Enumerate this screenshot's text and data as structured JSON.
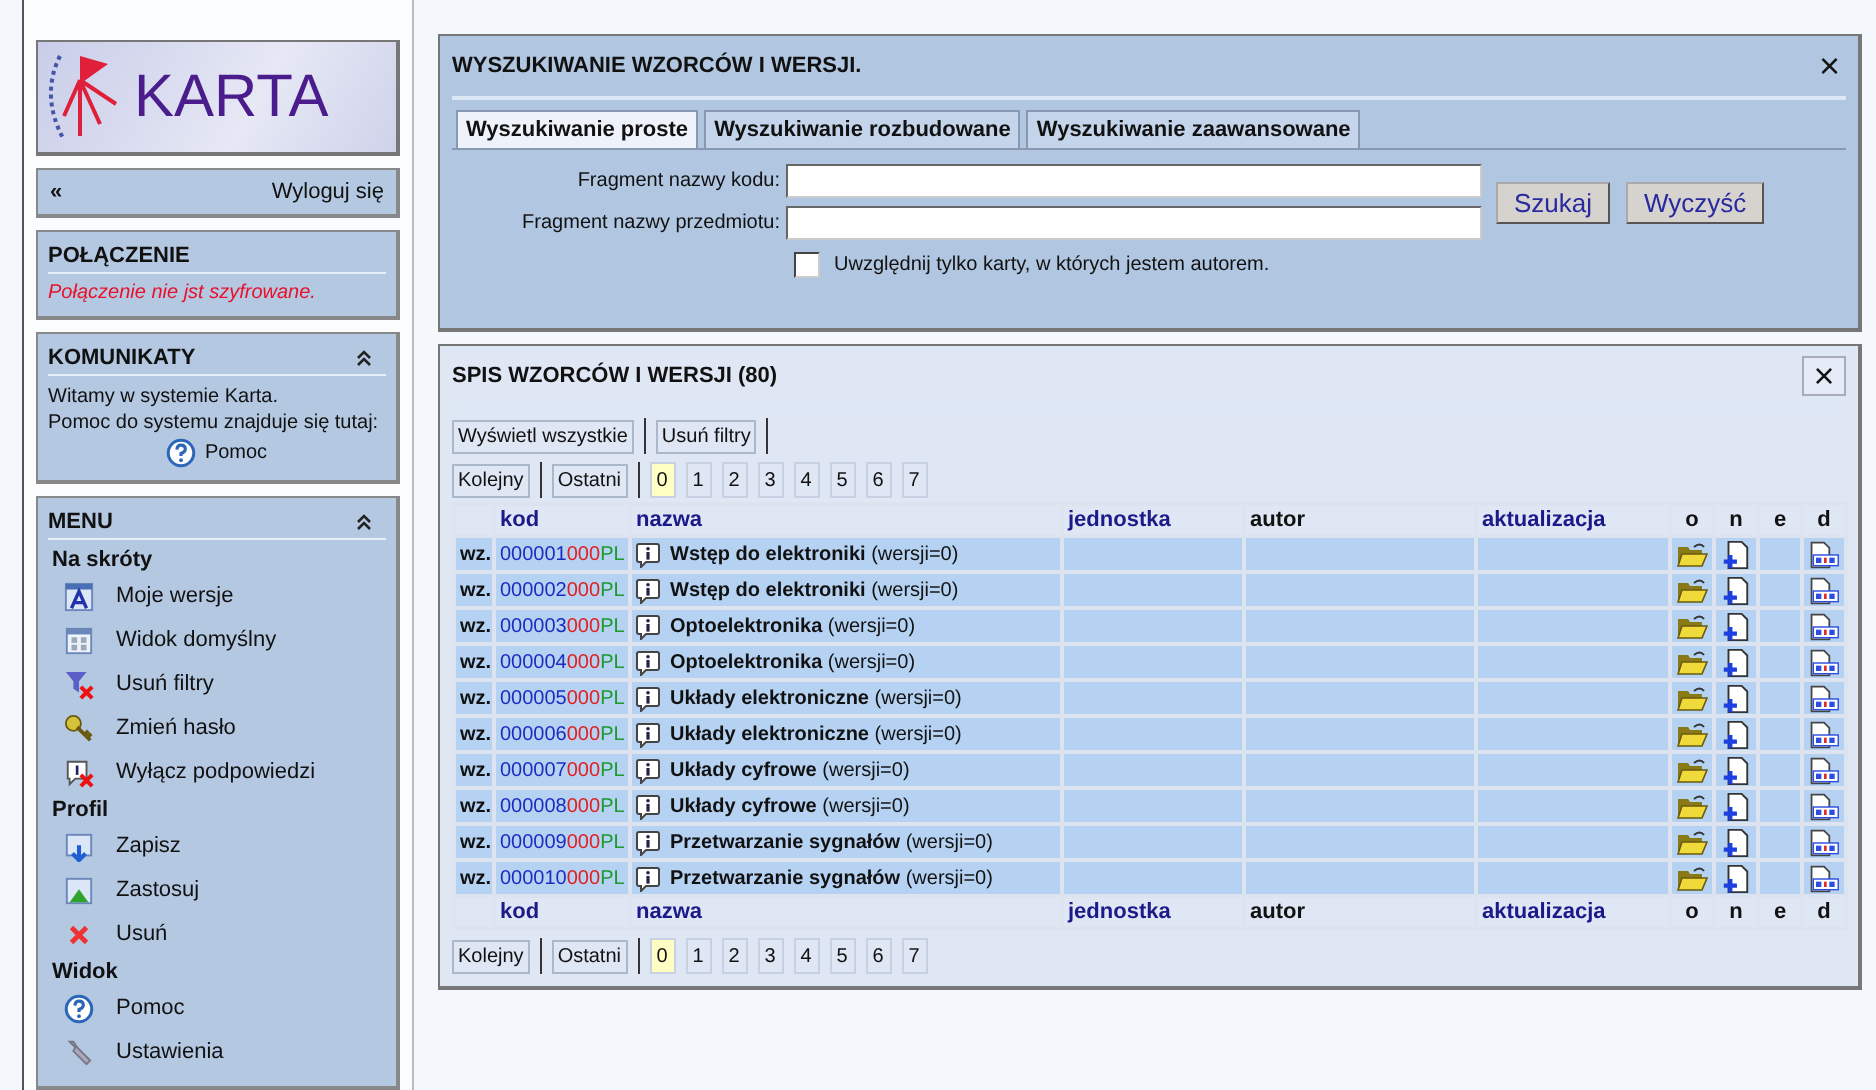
{
  "logo": {
    "text": "KARTA"
  },
  "nav": {
    "back": "«",
    "logout": "Wyloguj się"
  },
  "connection": {
    "title": "POŁĄCZENIE",
    "message": "Połączenie nie jst szyfrowane."
  },
  "messages": {
    "title": "KOMUNIKATY",
    "expanded": true,
    "lines": [
      "Witamy w systemie Karta.",
      "Pomoc do systemu znajduje się tutaj:"
    ],
    "help_link": "Pomoc"
  },
  "menu": {
    "title": "MENU",
    "expanded": true,
    "sections": [
      {
        "title": "Na skróty",
        "items": [
          {
            "label": "Moje wersje",
            "kind": "font"
          },
          {
            "label": "Widok domyślny",
            "kind": "grid"
          },
          {
            "label": "Usuń filtry",
            "kind": "filter"
          },
          {
            "label": "Zmień hasło",
            "kind": "key"
          },
          {
            "label": "Wyłącz podpowiedzi",
            "kind": "hint"
          }
        ]
      },
      {
        "title": "Profil",
        "items": [
          {
            "label": "Zapisz",
            "kind": "save"
          },
          {
            "label": "Zastosuj",
            "kind": "apply"
          },
          {
            "label": "Usuń",
            "kind": "delete"
          }
        ]
      },
      {
        "title": "Widok",
        "items": [
          {
            "label": "Pomoc",
            "kind": "help"
          },
          {
            "label": "Ustawienia",
            "kind": "wrench"
          }
        ]
      }
    ]
  },
  "search": {
    "title": "WYSZUKIWANIE WZORCÓW I WERSJI.",
    "close": "×",
    "tabs": [
      {
        "label": "Wyszukiwanie proste",
        "selected": true
      },
      {
        "label": "Wyszukiwanie rozbudowane",
        "selected": false
      },
      {
        "label": "Wyszukiwanie zaawansowane",
        "selected": false
      }
    ],
    "fields": [
      {
        "label": "Fragment nazwy kodu:"
      },
      {
        "label": "Fragment nazwy przedmiotu:"
      }
    ],
    "buttons": [
      "Szukaj",
      "Wyczyść"
    ],
    "only_mine": {
      "label": "Uwzględnij tylko karty, w których jestem autorem.",
      "checked": false
    }
  },
  "list": {
    "title": "SPIS WZORCÓW I WERSJI (80)",
    "close": "×",
    "actions": [
      "Wyświetl wszystkie",
      "Usuń filtry"
    ],
    "pager_top": {
      "nav": [
        "Kolejny",
        "Ostatni"
      ],
      "pages": [
        {
          "label": "0",
          "selected": true
        },
        {
          "label": "1",
          "selected": false
        },
        {
          "label": "2",
          "selected": false
        },
        {
          "label": "3",
          "selected": false
        },
        {
          "label": "4",
          "selected": false
        },
        {
          "label": "5",
          "selected": false
        },
        {
          "label": "6",
          "selected": false
        },
        {
          "label": "7",
          "selected": false
        }
      ]
    },
    "columns": [
      {
        "label": "kod",
        "sortable": true
      },
      {
        "label": "nazwa",
        "sortable": true
      },
      {
        "label": "jednostka",
        "sortable": true
      },
      {
        "label": "autor",
        "sortable": false
      },
      {
        "label": "aktualizacja",
        "sortable": true
      },
      {
        "label": "o",
        "sortable": false
      },
      {
        "label": "n",
        "sortable": false
      },
      {
        "label": "e",
        "sortable": false
      },
      {
        "label": "d",
        "sortable": false
      }
    ],
    "rows": [
      {
        "type": "wz.",
        "code": [
          "000001",
          "000",
          "PL"
        ],
        "name": "**Wstęp do elektroniki** (wersji=0)"
      },
      {
        "type": "wz.",
        "code": [
          "000002",
          "000",
          "PL"
        ],
        "name": "**Wstęp do elektroniki** (wersji=0)"
      },
      {
        "type": "wz.",
        "code": [
          "000003",
          "000",
          "PL"
        ],
        "name": "**Optoelektronika** (wersji=0)"
      },
      {
        "type": "wz.",
        "code": [
          "000004",
          "000",
          "PL"
        ],
        "name": "**Optoelektronika** (wersji=0)"
      },
      {
        "type": "wz.",
        "code": [
          "000005",
          "000",
          "PL"
        ],
        "name": "**Układy elektroniczne** (wersji=0)"
      },
      {
        "type": "wz.",
        "code": [
          "000006",
          "000",
          "PL"
        ],
        "name": "**Układy elektroniczne** (wersji=0)"
      },
      {
        "type": "wz.",
        "code": [
          "000007",
          "000",
          "PL"
        ],
        "name": "**Układy cyfrowe** (wersji=0)"
      },
      {
        "type": "wz.",
        "code": [
          "000008",
          "000",
          "PL"
        ],
        "name": "**Układy cyfrowe** (wersji=0)"
      },
      {
        "type": "wz.",
        "code": [
          "000009",
          "000",
          "PL"
        ],
        "name": "**Przetwarzanie sygnałów** (wersji=0)"
      },
      {
        "type": "wz.",
        "code": [
          "000010",
          "000",
          "PL"
        ],
        "name": "**Przetwarzanie sygnałów** (wersji=0)"
      }
    ],
    "footer_columns": [
      {
        "label": "kod",
        "sortable": true
      },
      {
        "label": "nazwa",
        "sortable": true
      },
      {
        "label": "jednostka",
        "sortable": true
      },
      {
        "label": "autor",
        "sortable": false
      },
      {
        "label": "aktualizacja",
        "sortable": true
      },
      {
        "label": "o",
        "sortable": false
      },
      {
        "label": "n",
        "sortable": false
      },
      {
        "label": "e",
        "sortable": false
      },
      {
        "label": "d",
        "sortable": false
      }
    ],
    "pager_bottom": {
      "nav": [
        "Kolejny",
        "Ostatni"
      ],
      "pages": [
        {
          "label": "0",
          "selected": true
        },
        {
          "label": "1",
          "selected": false
        },
        {
          "label": "2",
          "selected": false
        },
        {
          "label": "3",
          "selected": false
        },
        {
          "label": "4",
          "selected": false
        },
        {
          "label": "5",
          "selected": false
        },
        {
          "label": "6",
          "selected": false
        },
        {
          "label": "7",
          "selected": false
        }
      ]
    }
  }
}
